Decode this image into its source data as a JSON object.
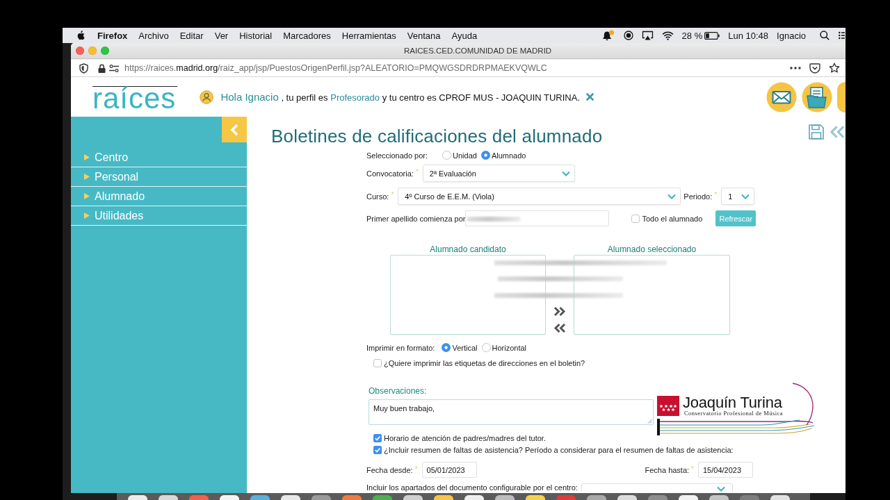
{
  "menu_bar": {
    "app_name": "Firefox",
    "menus": [
      "Archivo",
      "Editar",
      "Ver",
      "Historial",
      "Marcadores",
      "Herramientas",
      "Ventana",
      "Ayuda"
    ],
    "battery": "28 %",
    "clock": "Lun 10:48",
    "user": "Ignacio"
  },
  "window": {
    "title": "RAICES.CED.COMUNIDAD DE MADRID"
  },
  "address_bar": {
    "url_start": "https://raices.",
    "url_domain": "madrid.org",
    "url_rest": "/raiz_app/jsp/PuestosOrigenPerfil.jsp?ALEATORIO=PMQWGSDRDRPMAEKVQWLC"
  },
  "header": {
    "logo": "raíces",
    "greeting": {
      "salutation": "Hola Ignacio",
      "profile_text": ", tu perfil es",
      "profile": "Profesorado",
      "centre_text": "y tu centro es CPROF MUS - JOAQUIN TURINA."
    }
  },
  "sidebar": {
    "items": [
      "Centro",
      "Personal",
      "Alumnado",
      "Utilidades"
    ]
  },
  "page": {
    "title": "Boletines de calificaciones del alumnado"
  },
  "form": {
    "selection_mode": {
      "label": "Seleccionado por:",
      "options": [
        {
          "label": "Unidad",
          "selected": false
        },
        {
          "label": "Alumnado",
          "selected": true
        }
      ]
    },
    "convocatoria": {
      "label": "Convocatoria:",
      "required_mark": "*",
      "value": "2ª Evaluación"
    },
    "curso": {
      "label": "Curso:",
      "required_mark": "*",
      "value": "4º Curso de E.E.M. (Viola)"
    },
    "periodo": {
      "label": "Periodo:",
      "required_mark": "*",
      "value": "1"
    },
    "surname_filter": {
      "label": "Primer apellido comienza por"
    },
    "all_students": {
      "label": "Todo el alumnado",
      "checked": false
    },
    "refresh_button": "Refrescar",
    "candidates": {
      "title": "Alumnado candidato"
    },
    "selected_students": {
      "title": "Alumnado seleccionado"
    },
    "print_format": {
      "label": "Imprimir en formato:",
      "options": [
        {
          "label": "Vertical",
          "selected": true
        },
        {
          "label": "Horizontal",
          "selected": false
        }
      ]
    },
    "address_labels": {
      "label": "¿Quiere imprimir las etiquetas de direcciones en el boletin?",
      "checked": false
    },
    "observations": {
      "label": "Observaciones:",
      "value": "Muy buen trabajo,"
    },
    "school_logo": {
      "title": "Joaquín Turina",
      "subtitle": "Conservatorio Profesional de Música"
    },
    "report_options": [
      {
        "label": "Horario de atención de padres/madres del tutor.",
        "checked": true
      },
      {
        "label": "¿Incluir resumen de faltas de asistencia? Período a considerar para el resumen de faltas de asistencia:",
        "checked": true
      }
    ],
    "date_from": {
      "label": "Fecha desde:",
      "required_mark": "*",
      "value": "05/01/2023"
    },
    "date_to": {
      "label": "Fecha hasta:",
      "required_mark": "*",
      "value": "15/04/2023"
    },
    "configurable_sections": {
      "label": "Incluir los apartados del documento configurable por el centro:"
    }
  }
}
